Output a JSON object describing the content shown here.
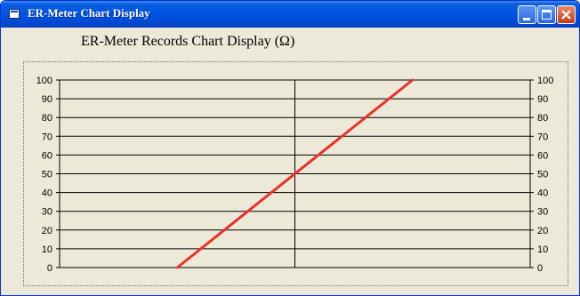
{
  "window": {
    "title": "ER-Meter Chart Display",
    "icons": {
      "app": "app-window-icon",
      "minimize": "minimize-icon",
      "maximize": "maximize-icon",
      "close": "close-icon"
    }
  },
  "chart_title": "ER-Meter Records Chart Display (Ω)",
  "chart_data": {
    "type": "line",
    "title": "ER-Meter Records Chart Display (Ω)",
    "xlabel": "",
    "ylabel": "",
    "ylim": [
      0,
      100
    ],
    "xlim": [
      0,
      1
    ],
    "y_ticks_left": [
      "0",
      "10",
      "20",
      "30",
      "40",
      "50",
      "60",
      "70",
      "80",
      "90",
      "100"
    ],
    "y_ticks_right": [
      "0",
      "10",
      "20",
      "30",
      "40",
      "50",
      "60",
      "70",
      "80",
      "90",
      "100"
    ],
    "grid": "horizontal lines every 10, one vertical center line",
    "series": [
      {
        "color": "#e8322a",
        "x": [
          0.25,
          0.75
        ],
        "y": [
          0,
          100
        ]
      }
    ]
  }
}
